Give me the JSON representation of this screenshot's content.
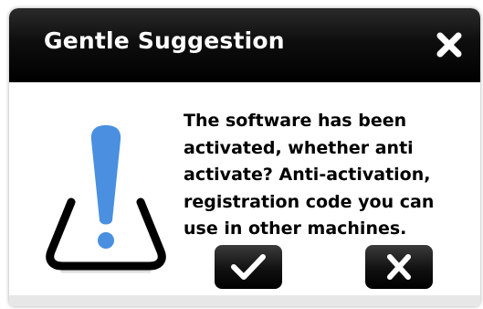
{
  "dialog": {
    "title": "Gentle Suggestion",
    "message": "The software has been\nactivated, whether anti\nactivate? Anti-activation,\nregistration code you can\nuse in other machines.",
    "close_icon": "close-x-icon",
    "warning_icon": "exclamation-warning-icon",
    "confirm_icon": "checkmark-icon",
    "cancel_icon": "cross-icon"
  },
  "colors": {
    "titlebar": "#000000",
    "title_text": "#ffffff",
    "warning_blue": "#4a90e2",
    "button_bg": "#111111",
    "body_bg": "#ffffff"
  }
}
